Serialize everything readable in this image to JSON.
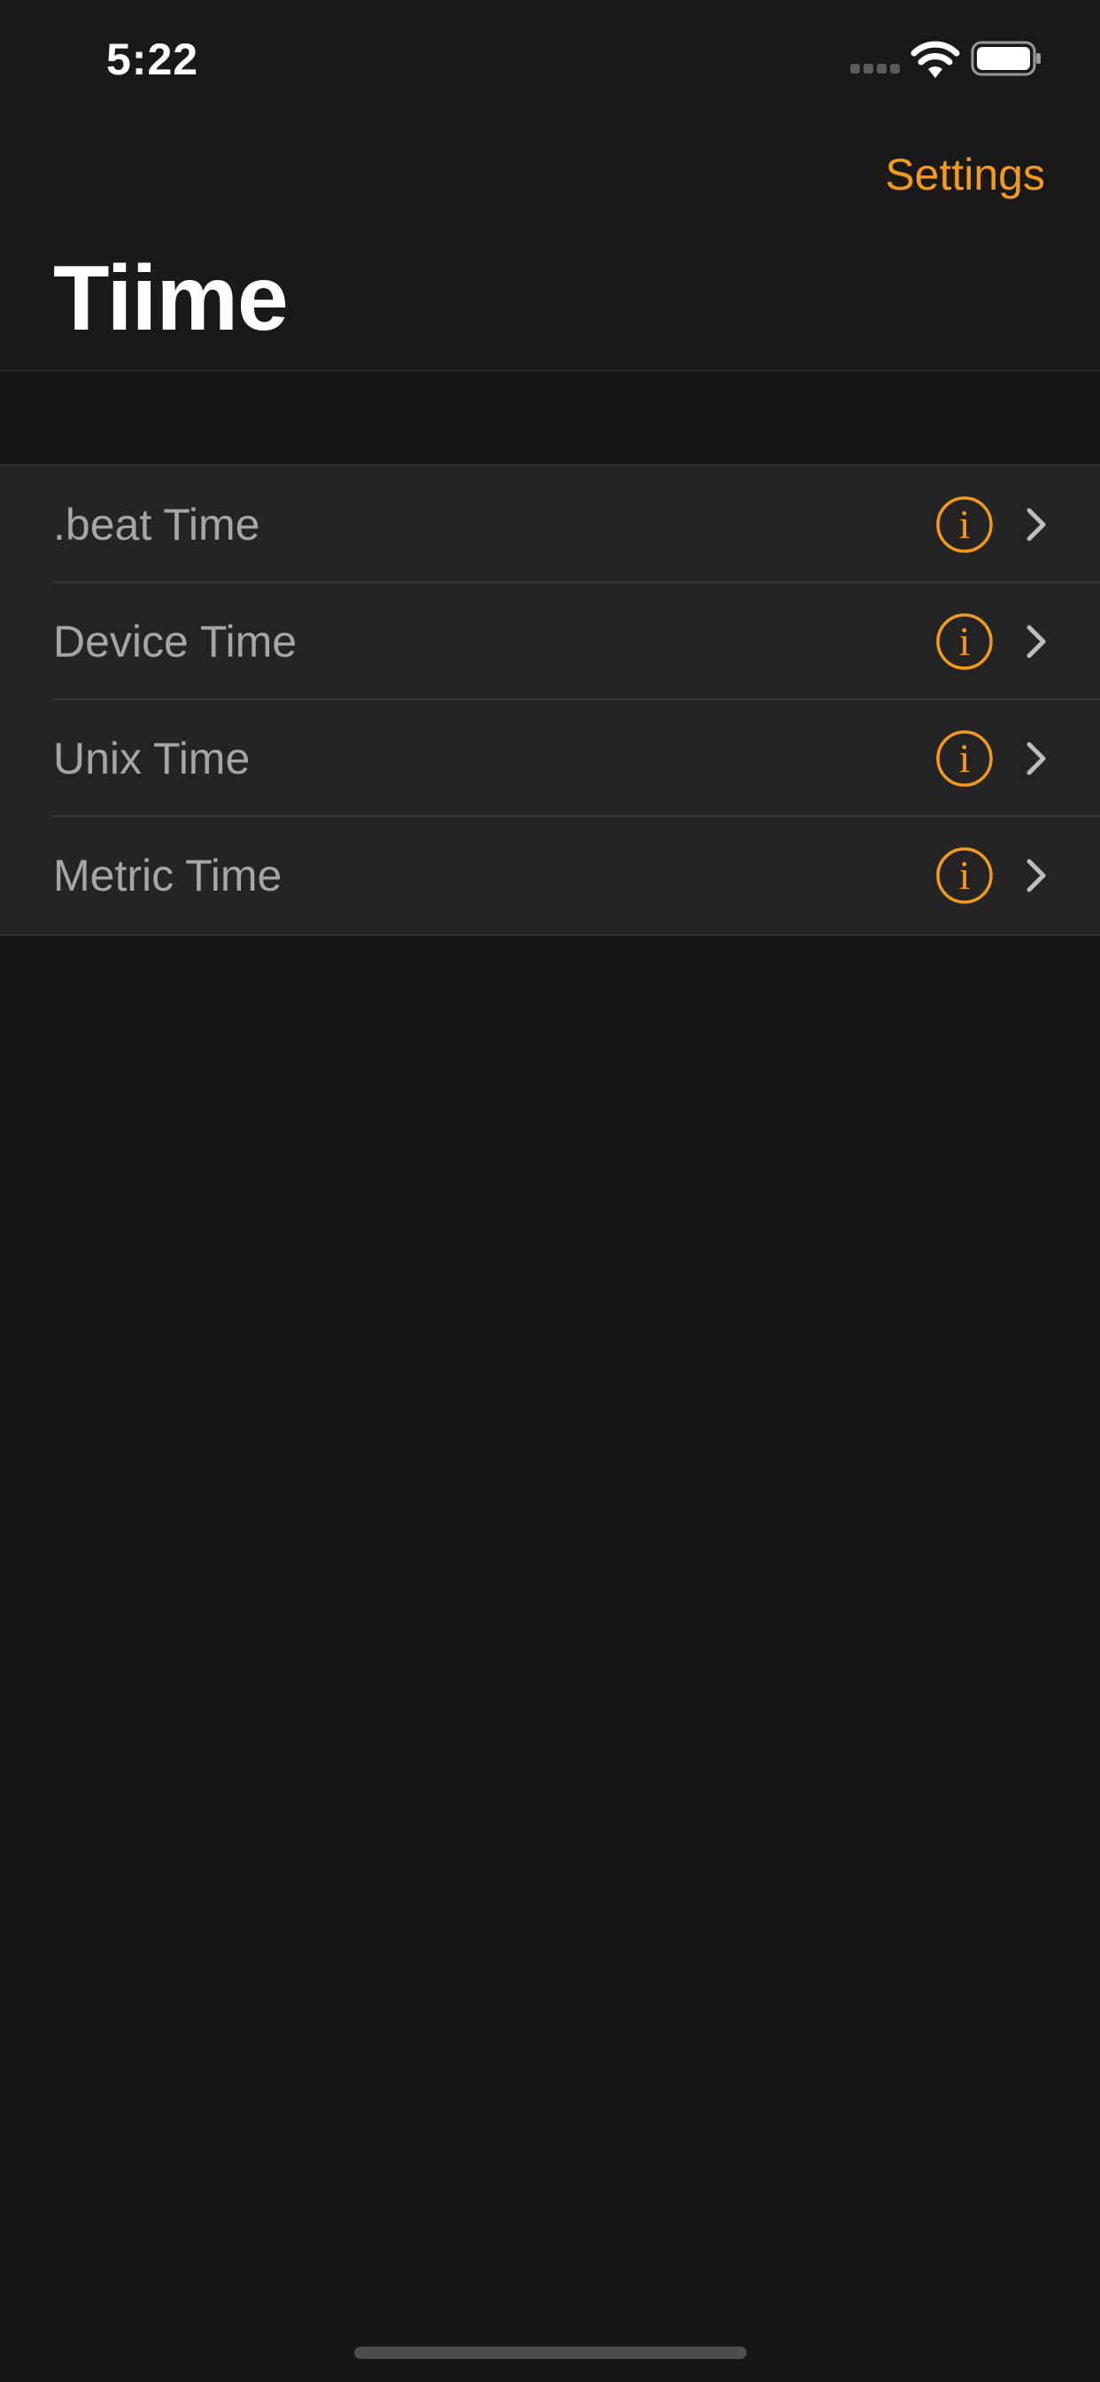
{
  "status_bar": {
    "time": "5:22",
    "signal_icon": "cellular-signal-icon",
    "wifi_icon": "wifi-icon",
    "battery_icon": "battery-icon"
  },
  "nav": {
    "settings_label": "Settings",
    "title": "Tiime"
  },
  "list": {
    "items": [
      {
        "label": ".beat Time",
        "info_icon": "info-icon",
        "disclosure_icon": "chevron-right-icon"
      },
      {
        "label": "Device Time",
        "info_icon": "info-icon",
        "disclosure_icon": "chevron-right-icon"
      },
      {
        "label": "Unix Time",
        "info_icon": "info-icon",
        "disclosure_icon": "chevron-right-icon"
      },
      {
        "label": "Metric Time",
        "info_icon": "info-icon",
        "disclosure_icon": "chevron-right-icon"
      }
    ]
  },
  "colors": {
    "accent": "#f39a1e",
    "background": "#171717",
    "row_background": "#242424",
    "row_text": "#a6a6a6"
  }
}
